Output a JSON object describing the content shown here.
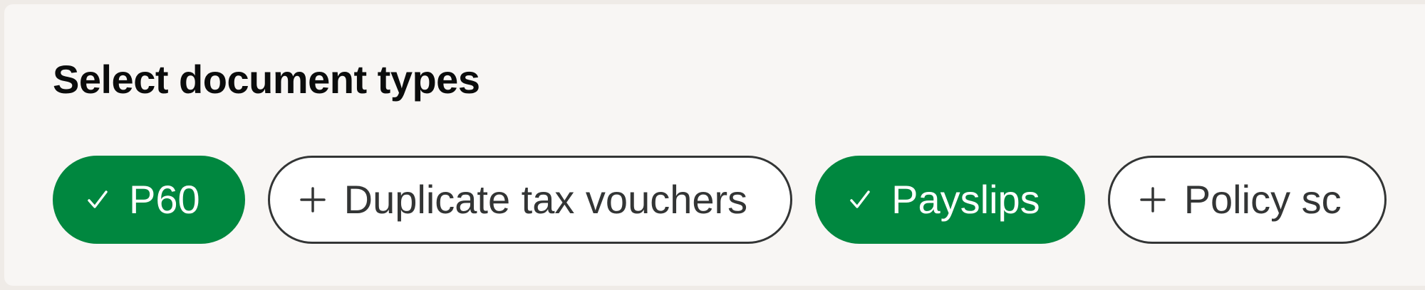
{
  "panel": {
    "title": "Select document types"
  },
  "chips": [
    {
      "label": "P60",
      "selected": true,
      "icon": "check-icon"
    },
    {
      "label": "Duplicate tax vouchers",
      "selected": false,
      "icon": "plus-icon"
    },
    {
      "label": "Payslips",
      "selected": true,
      "icon": "check-icon"
    },
    {
      "label": "Policy sc",
      "selected": false,
      "icon": "plus-icon"
    }
  ],
  "colors": {
    "selected_bg": "#00873f",
    "selected_text": "#ffffff",
    "unselected_border": "#333535",
    "panel_bg": "#f8f6f4"
  }
}
